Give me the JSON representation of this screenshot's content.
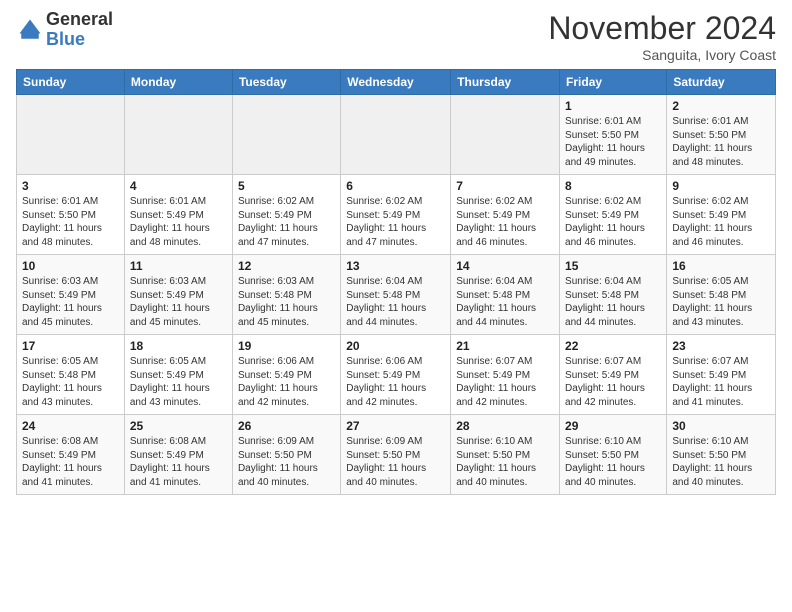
{
  "header": {
    "logo_general": "General",
    "logo_blue": "Blue",
    "month": "November 2024",
    "location": "Sanguita, Ivory Coast"
  },
  "weekdays": [
    "Sunday",
    "Monday",
    "Tuesday",
    "Wednesday",
    "Thursday",
    "Friday",
    "Saturday"
  ],
  "weeks": [
    [
      {
        "day": "",
        "info": ""
      },
      {
        "day": "",
        "info": ""
      },
      {
        "day": "",
        "info": ""
      },
      {
        "day": "",
        "info": ""
      },
      {
        "day": "",
        "info": ""
      },
      {
        "day": "1",
        "info": "Sunrise: 6:01 AM\nSunset: 5:50 PM\nDaylight: 11 hours and 49 minutes."
      },
      {
        "day": "2",
        "info": "Sunrise: 6:01 AM\nSunset: 5:50 PM\nDaylight: 11 hours and 48 minutes."
      }
    ],
    [
      {
        "day": "3",
        "info": "Sunrise: 6:01 AM\nSunset: 5:50 PM\nDaylight: 11 hours and 48 minutes."
      },
      {
        "day": "4",
        "info": "Sunrise: 6:01 AM\nSunset: 5:49 PM\nDaylight: 11 hours and 48 minutes."
      },
      {
        "day": "5",
        "info": "Sunrise: 6:02 AM\nSunset: 5:49 PM\nDaylight: 11 hours and 47 minutes."
      },
      {
        "day": "6",
        "info": "Sunrise: 6:02 AM\nSunset: 5:49 PM\nDaylight: 11 hours and 47 minutes."
      },
      {
        "day": "7",
        "info": "Sunrise: 6:02 AM\nSunset: 5:49 PM\nDaylight: 11 hours and 46 minutes."
      },
      {
        "day": "8",
        "info": "Sunrise: 6:02 AM\nSunset: 5:49 PM\nDaylight: 11 hours and 46 minutes."
      },
      {
        "day": "9",
        "info": "Sunrise: 6:02 AM\nSunset: 5:49 PM\nDaylight: 11 hours and 46 minutes."
      }
    ],
    [
      {
        "day": "10",
        "info": "Sunrise: 6:03 AM\nSunset: 5:49 PM\nDaylight: 11 hours and 45 minutes."
      },
      {
        "day": "11",
        "info": "Sunrise: 6:03 AM\nSunset: 5:49 PM\nDaylight: 11 hours and 45 minutes."
      },
      {
        "day": "12",
        "info": "Sunrise: 6:03 AM\nSunset: 5:48 PM\nDaylight: 11 hours and 45 minutes."
      },
      {
        "day": "13",
        "info": "Sunrise: 6:04 AM\nSunset: 5:48 PM\nDaylight: 11 hours and 44 minutes."
      },
      {
        "day": "14",
        "info": "Sunrise: 6:04 AM\nSunset: 5:48 PM\nDaylight: 11 hours and 44 minutes."
      },
      {
        "day": "15",
        "info": "Sunrise: 6:04 AM\nSunset: 5:48 PM\nDaylight: 11 hours and 44 minutes."
      },
      {
        "day": "16",
        "info": "Sunrise: 6:05 AM\nSunset: 5:48 PM\nDaylight: 11 hours and 43 minutes."
      }
    ],
    [
      {
        "day": "17",
        "info": "Sunrise: 6:05 AM\nSunset: 5:48 PM\nDaylight: 11 hours and 43 minutes."
      },
      {
        "day": "18",
        "info": "Sunrise: 6:05 AM\nSunset: 5:49 PM\nDaylight: 11 hours and 43 minutes."
      },
      {
        "day": "19",
        "info": "Sunrise: 6:06 AM\nSunset: 5:49 PM\nDaylight: 11 hours and 42 minutes."
      },
      {
        "day": "20",
        "info": "Sunrise: 6:06 AM\nSunset: 5:49 PM\nDaylight: 11 hours and 42 minutes."
      },
      {
        "day": "21",
        "info": "Sunrise: 6:07 AM\nSunset: 5:49 PM\nDaylight: 11 hours and 42 minutes."
      },
      {
        "day": "22",
        "info": "Sunrise: 6:07 AM\nSunset: 5:49 PM\nDaylight: 11 hours and 42 minutes."
      },
      {
        "day": "23",
        "info": "Sunrise: 6:07 AM\nSunset: 5:49 PM\nDaylight: 11 hours and 41 minutes."
      }
    ],
    [
      {
        "day": "24",
        "info": "Sunrise: 6:08 AM\nSunset: 5:49 PM\nDaylight: 11 hours and 41 minutes."
      },
      {
        "day": "25",
        "info": "Sunrise: 6:08 AM\nSunset: 5:49 PM\nDaylight: 11 hours and 41 minutes."
      },
      {
        "day": "26",
        "info": "Sunrise: 6:09 AM\nSunset: 5:50 PM\nDaylight: 11 hours and 40 minutes."
      },
      {
        "day": "27",
        "info": "Sunrise: 6:09 AM\nSunset: 5:50 PM\nDaylight: 11 hours and 40 minutes."
      },
      {
        "day": "28",
        "info": "Sunrise: 6:10 AM\nSunset: 5:50 PM\nDaylight: 11 hours and 40 minutes."
      },
      {
        "day": "29",
        "info": "Sunrise: 6:10 AM\nSunset: 5:50 PM\nDaylight: 11 hours and 40 minutes."
      },
      {
        "day": "30",
        "info": "Sunrise: 6:10 AM\nSunset: 5:50 PM\nDaylight: 11 hours and 40 minutes."
      }
    ]
  ]
}
